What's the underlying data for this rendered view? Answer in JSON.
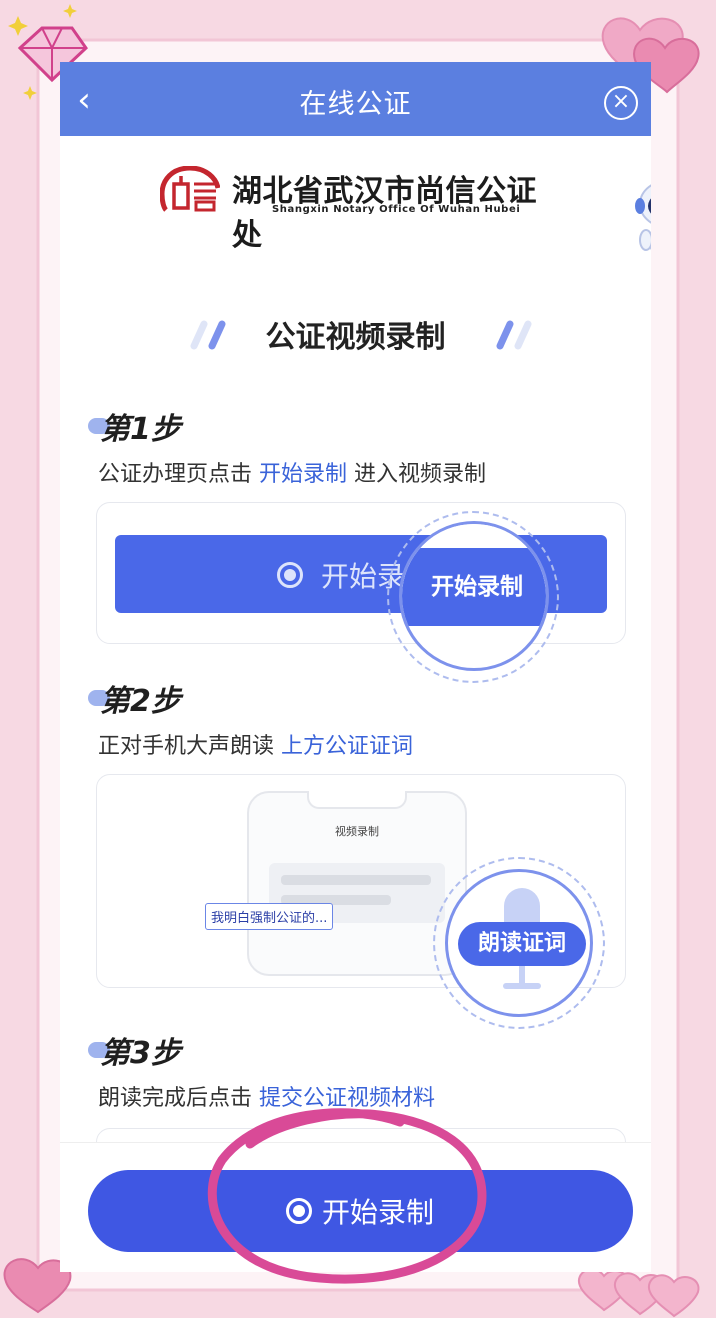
{
  "topbar": {
    "back_icon": "chevron-left-icon",
    "title": "在线公证",
    "close_icon": "close-circle-icon"
  },
  "logo": {
    "mark_text": "尚信",
    "name_cn": "湖北省武汉市尚信公证处",
    "name_en": "Shangxin Notary Office Of Wuhan Hubei"
  },
  "section_title": "公证视频录制",
  "steps": [
    {
      "heading": "第1步",
      "desc_prefix": "公证办理页点击 ",
      "desc_highlight": "开始录制",
      "desc_suffix": " 进入视频录制",
      "demo_button_label": "开始录",
      "magnified_label": "开始录制"
    },
    {
      "heading": "第2步",
      "desc_prefix": "正对手机大声朗读 ",
      "desc_highlight": "上方公证证词",
      "desc_suffix": "",
      "mini_phone_title": "视频录制",
      "mini_tag": "我明白强制公证的...",
      "magnified_label": "朗读证词"
    },
    {
      "heading": "第3步",
      "desc_prefix": "朗读完成后点击 ",
      "desc_highlight": "提交公证视频材料",
      "desc_suffix": ""
    }
  ],
  "main_button": {
    "label": "开始录制",
    "icon": "record-radio-icon"
  },
  "colors": {
    "topbar": "#5b7fe0",
    "accent": "#3f57e3",
    "highlight_text": "#3a63d9",
    "annotation_pink": "#d94a97",
    "background": "#f7d9e3"
  }
}
